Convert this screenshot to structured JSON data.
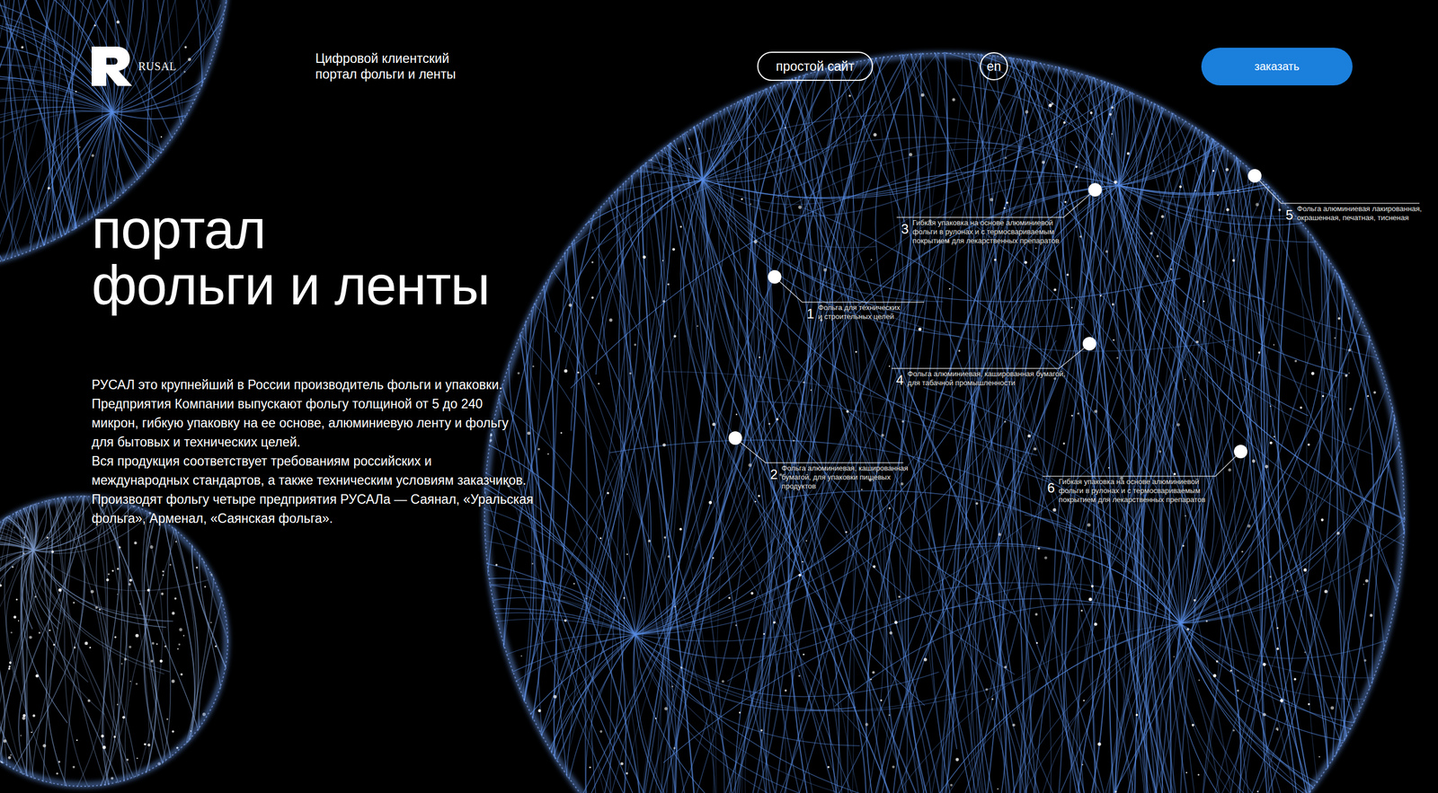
{
  "header": {
    "logo": "RUSAL",
    "subtitle": [
      "Цифровой клиентский",
      "портал фольги и ленты"
    ],
    "simple_site": "простой сайт",
    "language": "en",
    "order": "заказать"
  },
  "hero": {
    "title": [
      "портал",
      "фольги и ленты"
    ],
    "description": [
      "РУСАЛ это крупнейший в России производитель фольги и упаковки.",
      "Предприятия Компании выпускают фольгу толщиной от 5 до 240",
      "микрон, гибкую упаковку на ее основе, алюминиевую ленту и фольгу",
      "для бытовых и технических целей.",
      "Вся продукция соответствует требованиям российских и",
      "международных стандартов, а также техническим условиям заказчиков.",
      "Производят фольгу четыре предприятия РУСАЛа — Саянал, «Уральская",
      "фольга», Арменал, «Саянская фольга»."
    ]
  },
  "callouts": [
    {
      "number": "1",
      "lines": [
        "Фольга для технических",
        "и строительных целей"
      ]
    },
    {
      "number": "2",
      "lines": [
        "Фольга алюминиевая, кашированная",
        "бумагой, для упаковки пищевых",
        "продуктов"
      ]
    },
    {
      "number": "3",
      "lines": [
        "Гибкая упаковка на основе алюминиевой",
        "фольги в рулонах и с термосвариваемым",
        "покрытием для лекарственных препаратов"
      ]
    },
    {
      "number": "4",
      "lines": [
        "Фольга алюминиевая, кашированная бумагой,",
        "для табачной промышленности"
      ]
    },
    {
      "number": "5",
      "lines": [
        "Фольга алюминиевая лакированная,",
        "окрашенная, печатная, тисненая"
      ]
    },
    {
      "number": "6",
      "lines": [
        "Гибкая упаковка на основе алюминиевой",
        "фольги в рулонах и с термосвариваемым",
        "покрытием для лекарственных препаратов"
      ]
    }
  ]
}
